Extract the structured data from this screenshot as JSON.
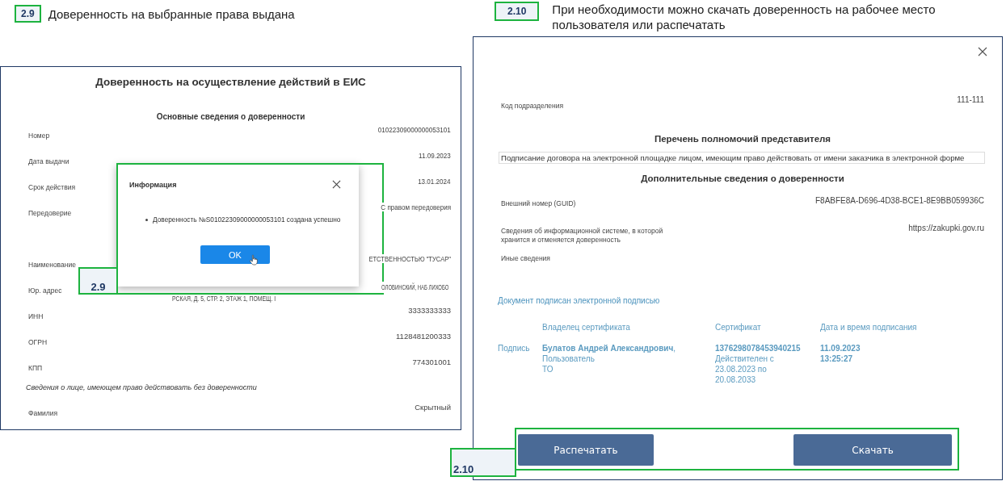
{
  "steps": [
    {
      "badge": "2.9",
      "caption": "Доверенность на выбранные права выдана"
    },
    {
      "badge": "2.10",
      "caption": "При необходимости можно скачать доверенность на рабочее место пользователя или распечатать"
    }
  ],
  "left_screen": {
    "title": "Доверенность на осуществление действий в ЕИС",
    "section_title": "Основные сведения о доверенности",
    "fields_top": [
      {
        "label": "Номер",
        "value": "01022309000000053101"
      },
      {
        "label": "Дата выдачи",
        "value": "11.09.2023"
      },
      {
        "label": "Срок действия",
        "value": "13.01.2024"
      },
      {
        "label": "Передоверие",
        "value": "С правом передоверия"
      }
    ],
    "fields_org": [
      {
        "label": "Наименование",
        "value": "ЕТСТВЕННОСТЬЮ \"ТУСАР\""
      },
      {
        "label": "Юр. адрес",
        "value_lines": [
          "ОЛОВИНСКИЙ, НАБ ЛИХОБО",
          "РСКАЯ, Д. 5, СТР. 2, ЭТАЖ 1, ПОМЕЩ. I"
        ]
      },
      {
        "label": "ИНН",
        "value": "3333333333"
      },
      {
        "label": "ОГРН",
        "value": "1128481200333"
      },
      {
        "label": "КПП",
        "value": "774301001"
      }
    ],
    "note": "Сведения о лице, имеющем право действовать без доверенности",
    "fields_person": [
      {
        "label": "Фамилия",
        "value": "Скрытный"
      }
    ],
    "dialog": {
      "title": "Информация",
      "message": "Доверенность №S01022309000000053101 создана успешно",
      "ok_button": "OK",
      "callout": "2.9"
    }
  },
  "right_screen": {
    "fields_top": [
      {
        "label": "Код подразделения",
        "value": "111-111"
      }
    ],
    "powers_title": "Перечень полномочий представителя",
    "powers": [
      "Подписание договора на электронной площадке лицом, имеющим право действовать от имени заказчика в электронной форме"
    ],
    "extra_title": "Дополнительные сведения о доверенности",
    "fields_extra": [
      {
        "label": "Внешний номер (GUID)",
        "value": "F8ABFE8A-D696-4D38-BCE1-8E9BB059936C"
      },
      {
        "label": "Сведения об информационной системе, в которой хранится и отменяется доверенность",
        "value": "https://zakupki.gov.ru"
      },
      {
        "label": "Иные сведения"
      }
    ],
    "signed_link": "Документ подписан электронной подписью",
    "signature": {
      "headers": [
        "Владелец сертификата",
        "Сертификат",
        "Дата и время подписания"
      ],
      "row_label": "Подпись",
      "owner": "**Булатов Андрей Александрович**,\nПользователь\nТО",
      "certificate": "**1376298078453940215**\nДействителен с\n23.08.2023 по\n20.08.2033",
      "signed_at": "11.09.2023\n13:25:27"
    },
    "buttons": [
      "Распечатать",
      "Скачать"
    ],
    "callout": "2.10"
  }
}
